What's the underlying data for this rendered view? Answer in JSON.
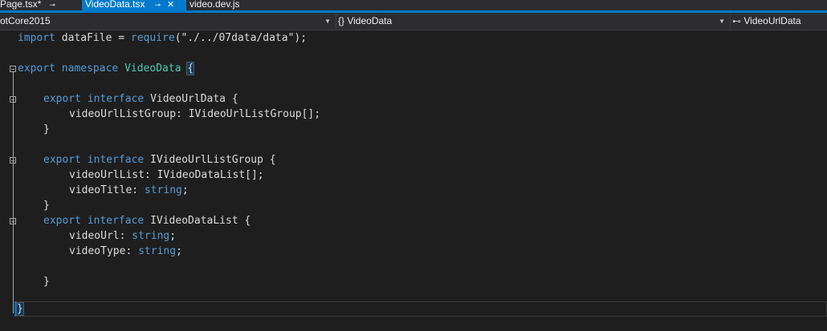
{
  "tabs": [
    {
      "label": "Page.tsx*",
      "pin": "⊸"
    },
    {
      "label": "VideoData.tsx",
      "pin": "⊸",
      "close": "✕"
    },
    {
      "label": "video.dev.js"
    }
  ],
  "navbar": {
    "project": "otCore2015",
    "scope": "{} VideoData",
    "member": "VideoUrlData"
  },
  "code": {
    "l1": {
      "a": "import",
      "b": " dataFile = ",
      "c": "require",
      "d": "(\"./../07data/data\");"
    },
    "l3": {
      "a": "export",
      "b": " ",
      "c": "namespace",
      "d": " VideoData ",
      "e": "{"
    },
    "l5": {
      "a": "export",
      "b": " ",
      "c": "interface",
      "d": " VideoUrlData {"
    },
    "l6": {
      "a": "videoUrlListGroup: ",
      "b": "IVideoUrlListGroup",
      "c": "[];"
    },
    "l7": {
      "a": "}"
    },
    "l9": {
      "a": "export",
      "b": " ",
      "c": "interface",
      "d": " IVideoUrlListGroup {"
    },
    "l10": {
      "a": "videoUrlList: ",
      "b": "IVideoDataList",
      "c": "[];"
    },
    "l11": {
      "a": "videoTitle: ",
      "b": "string",
      "c": ";"
    },
    "l12": {
      "a": "}"
    },
    "l13": {
      "a": "export",
      "b": " ",
      "c": "interface",
      "d": " IVideoDataList {"
    },
    "l14": {
      "a": "videoUrl: ",
      "b": "string",
      "c": ";"
    },
    "l15": {
      "a": "videoType: ",
      "b": "string",
      "c": ";"
    },
    "l17": {
      "a": "}"
    },
    "l19": {
      "a": "}"
    }
  },
  "colors": {
    "accent": "#007acc",
    "keyword": "#569cd6",
    "type": "#4ec9b0",
    "string": "#d69d85"
  }
}
